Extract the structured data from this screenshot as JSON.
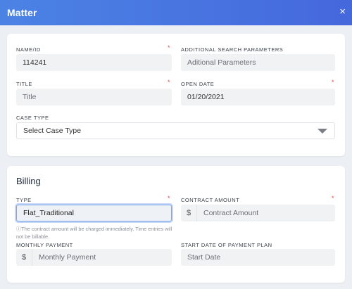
{
  "modal": {
    "title": "Matter",
    "close_glyph": "×"
  },
  "matter": {
    "name_id": {
      "label": "NAME/ID",
      "value": "114241",
      "required_mark": "*"
    },
    "additional_search": {
      "label": "ADDITIONAL SEARCH PARAMETERS",
      "placeholder": "Aditional Parameters"
    },
    "title": {
      "label": "TITLE",
      "placeholder": "Title",
      "required_mark": "*"
    },
    "open_date": {
      "label": "OPEN DATE",
      "value": "01/20/2021",
      "required_mark": "*"
    },
    "case_type": {
      "label": "CASE TYPE",
      "selected": "Select Case Type"
    }
  },
  "billing": {
    "heading": "Billing",
    "type": {
      "label": "TYPE",
      "value": "Flat_Traditional",
      "required_mark": "*"
    },
    "hint": "ⓘThe contract amount will be charged immediately. Time entries will not be billable.",
    "contract_amount": {
      "label": "CONTRACT AMOUNT",
      "prefix": "$",
      "placeholder": "Contract Amount",
      "required_mark": "*"
    },
    "monthly_payment": {
      "label": "MONTHLY PAYMENT",
      "prefix": "$",
      "placeholder": "Monthly Payment"
    },
    "start_date": {
      "label": "START DATE OF PAYMENT PLAN",
      "placeholder": "Start Date"
    }
  },
  "colors": {
    "header_start": "#4b83e4",
    "header_end": "#4568dd",
    "required": "#e24a4a",
    "focus_border": "#7aa7ea"
  }
}
